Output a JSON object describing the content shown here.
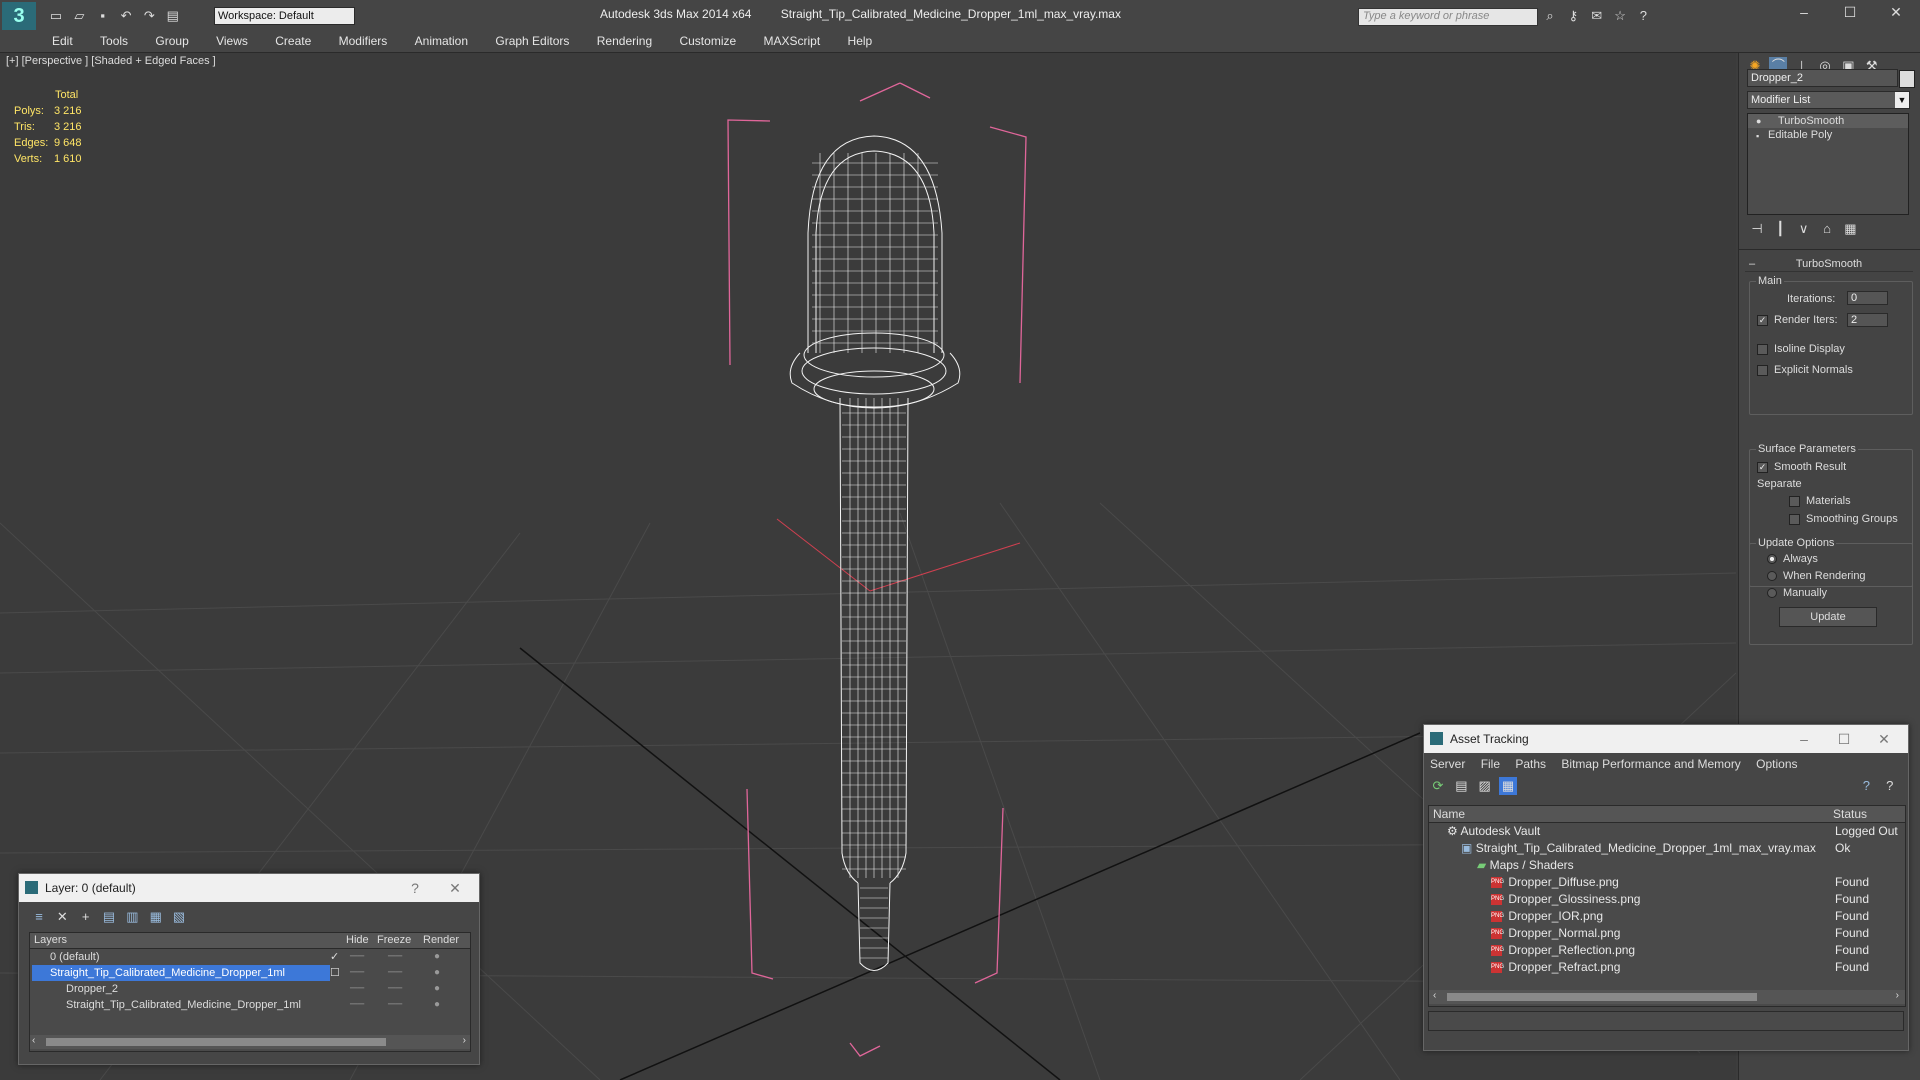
{
  "app": {
    "title": "Autodesk 3ds Max 2014 x64",
    "file": "Straight_Tip_Calibrated_Medicine_Dropper_1ml_max_vray.max",
    "workspace": "Workspace: Default",
    "search_placeholder": "Type a keyword or phrase"
  },
  "menu": [
    "Edit",
    "Tools",
    "Group",
    "Views",
    "Create",
    "Modifiers",
    "Animation",
    "Graph Editors",
    "Rendering",
    "Customize",
    "MAXScript",
    "Help"
  ],
  "viewport": {
    "label": "[+] [Perspective ] [Shaded + Edged Faces ]",
    "stats_header": "Total",
    "stats": [
      {
        "label": "Polys:",
        "value": "3 216"
      },
      {
        "label": "Tris:",
        "value": "3 216"
      },
      {
        "label": "Edges:",
        "value": "9 648"
      },
      {
        "label": "Verts:",
        "value": "1 610"
      }
    ]
  },
  "command_panel": {
    "object_name": "Dropper_2",
    "modifier_list": "Modifier List",
    "stack": [
      "TurboSmooth",
      "Editable Poly"
    ],
    "rollout_title": "TurboSmooth",
    "main_label": "Main",
    "iterations_label": "Iterations:",
    "iterations_value": "0",
    "render_iters_label": "Render Iters:",
    "render_iters_value": "2",
    "isoline": "Isoline Display",
    "explicit_normals": "Explicit Normals",
    "surface_params": "Surface Parameters",
    "smooth_result": "Smooth Result",
    "separate": "Separate",
    "materials": "Materials",
    "smoothing_groups": "Smoothing Groups",
    "update_options": "Update Options",
    "always": "Always",
    "when_rendering": "When Rendering",
    "manually": "Manually",
    "update_button": "Update"
  },
  "asset_tracking": {
    "title": "Asset Tracking",
    "menu": [
      "Server",
      "File",
      "Paths",
      "Bitmap Performance and Memory",
      "Options"
    ],
    "col_name": "Name",
    "col_status": "Status",
    "rows": [
      {
        "name": "Autodesk Vault",
        "status": "Logged Out"
      },
      {
        "name": "Straight_Tip_Calibrated_Medicine_Dropper_1ml_max_vray.max",
        "status": "Ok"
      },
      {
        "name": "Maps / Shaders",
        "status": ""
      },
      {
        "name": "Dropper_Diffuse.png",
        "status": "Found"
      },
      {
        "name": "Dropper_Glossiness.png",
        "status": "Found"
      },
      {
        "name": "Dropper_IOR.png",
        "status": "Found"
      },
      {
        "name": "Dropper_Normal.png",
        "status": "Found"
      },
      {
        "name": "Dropper_Reflection.png",
        "status": "Found"
      },
      {
        "name": "Dropper_Refract.png",
        "status": "Found"
      }
    ]
  },
  "layer_window": {
    "title": "Layer: 0 (default)",
    "help": "?",
    "col_layers": "Layers",
    "col_hide": "Hide",
    "col_freeze": "Freeze",
    "col_render": "Render",
    "rows": [
      "0 (default)",
      "Straight_Tip_Calibrated_Medicine_Dropper_1ml",
      "Dropper_2",
      "Straight_Tip_Calibrated_Medicine_Dropper_1ml"
    ]
  }
}
